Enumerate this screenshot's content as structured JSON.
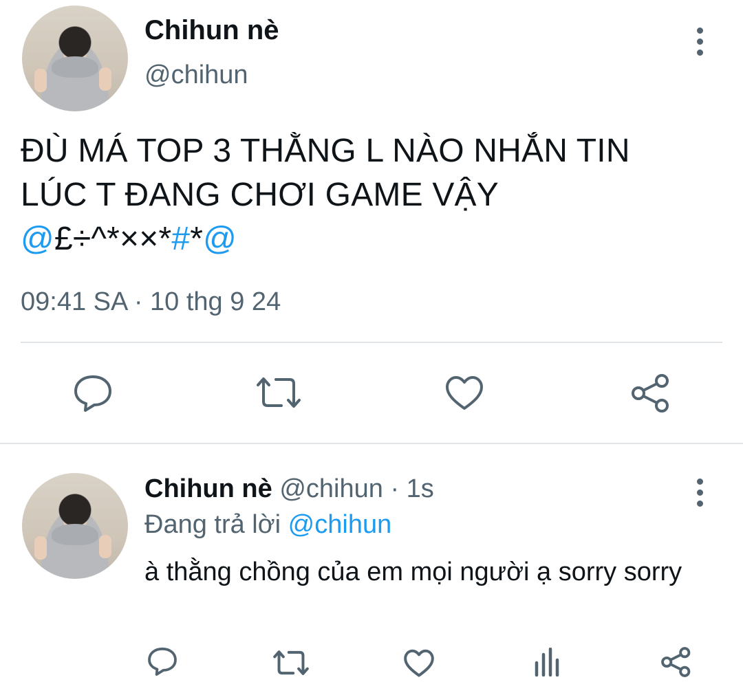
{
  "main_tweet": {
    "display_name": "Chihun nè",
    "handle": "@chihun",
    "text_line1": "ĐÙ MÁ TOP 3 THẰNG L NÀO NHẮN TIN",
    "text_line2": "LÚC T ĐANG CHƠI GAME VẬY",
    "symbols": {
      "at1": "@",
      "middle": "£÷^*××*",
      "hash": "#",
      "star": "*",
      "at2": "@"
    },
    "time": "09:41 SA",
    "separator": "·",
    "date": "10 thg 9 24",
    "actions": [
      "comment-icon",
      "retweet-icon",
      "like-icon",
      "share-icon"
    ]
  },
  "reply_tweet": {
    "display_name": "Chihun nè",
    "handle": "@chihun",
    "separator": "·",
    "age": "1s",
    "replying_prefix": "Đang trả lời",
    "replying_to": "@chihun",
    "text": "à thằng chồng của em mọi người ạ sorry sorry",
    "actions": [
      "comment-icon",
      "retweet-icon",
      "like-icon",
      "analytics-icon",
      "share-icon"
    ]
  },
  "colors": {
    "text": "#0f1419",
    "secondary": "#536471",
    "link": "#1d9bf0",
    "divider": "#e1e5e8"
  }
}
